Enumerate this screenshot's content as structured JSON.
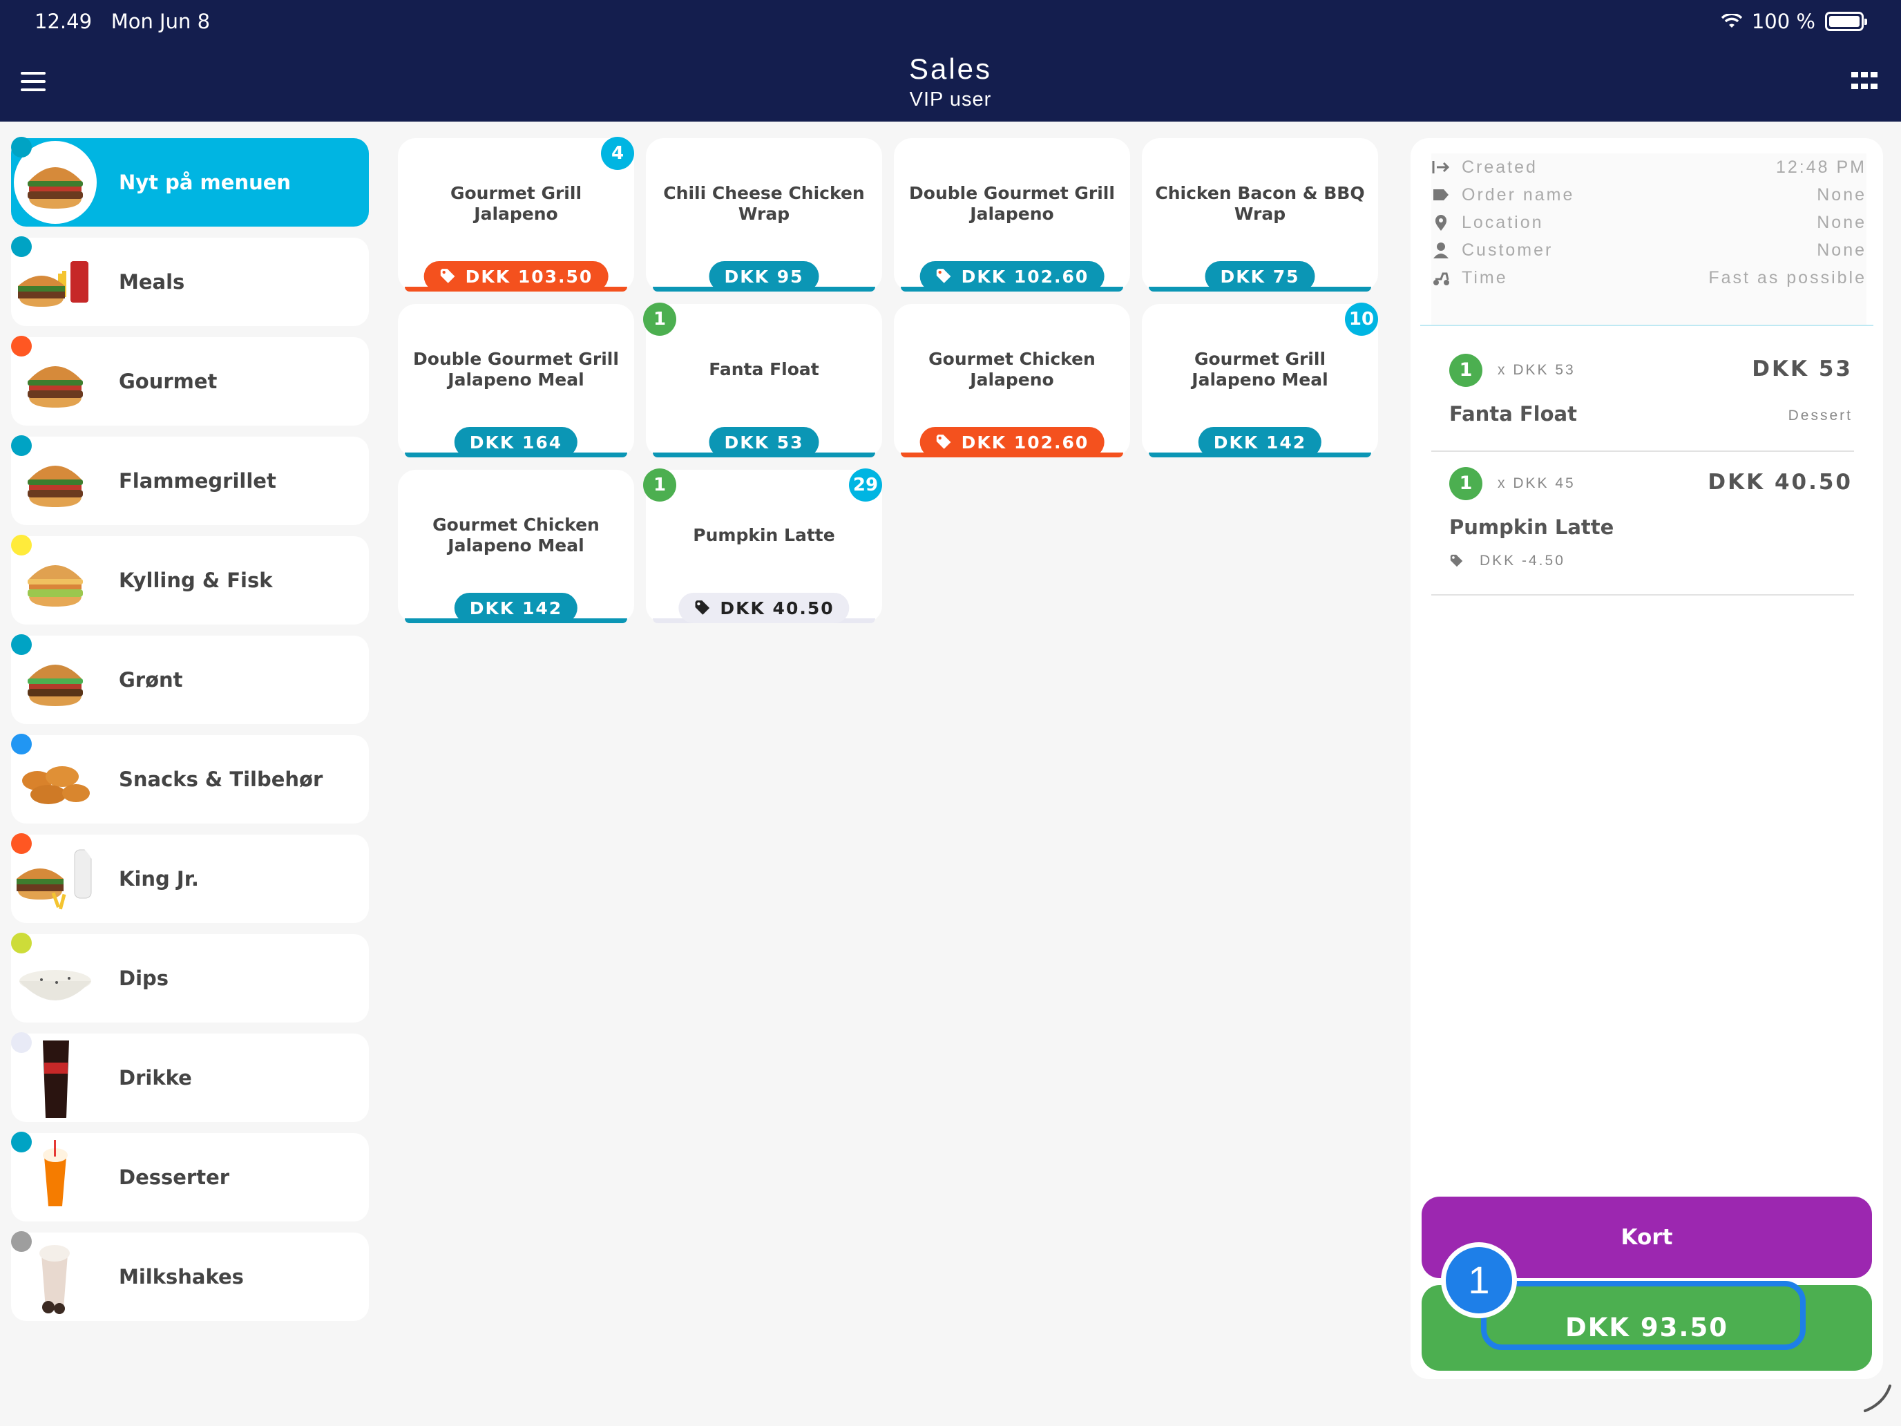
{
  "status": {
    "time": "12.49",
    "date": "Mon Jun 8",
    "battery": "100 %"
  },
  "header": {
    "title": "Sales",
    "subtitle": "VIP user"
  },
  "categories": [
    {
      "label": "Nyt på menuen",
      "dot": "#00a3c4",
      "active": true,
      "icon": "burger-icon"
    },
    {
      "label": "Meals",
      "dot": "#00a3c4",
      "icon": "meal-icon"
    },
    {
      "label": "Gourmet",
      "dot": "#ff5722",
      "icon": "burger-icon"
    },
    {
      "label": "Flammegrillet",
      "dot": "#00a3c4",
      "icon": "burger-icon"
    },
    {
      "label": "Kylling & Fisk",
      "dot": "#ffeb3b",
      "icon": "chicken-burger-icon"
    },
    {
      "label": "Grønt",
      "dot": "#00a3c4",
      "icon": "veggie-burger-icon"
    },
    {
      "label": "Snacks & Tilbehør",
      "dot": "#2196f3",
      "icon": "nuggets-icon"
    },
    {
      "label": "King Jr.",
      "dot": "#ff5722",
      "icon": "kids-meal-icon"
    },
    {
      "label": "Dips",
      "dot": "#cddc39",
      "icon": "dip-icon"
    },
    {
      "label": "Drikke",
      "dot": "#e8eaf6",
      "icon": "cola-icon"
    },
    {
      "label": "Desserter",
      "dot": "#00a3c4",
      "icon": "dessert-icon"
    },
    {
      "label": "Milkshakes",
      "dot": "#9e9e9e",
      "icon": "milkshake-icon"
    }
  ],
  "products": [
    {
      "name": "Gourmet Grill Jalapeno",
      "price": "DKK 103.50",
      "style": "discount",
      "badge": "4",
      "badge_side": "right",
      "badge_color": "#00b5e2"
    },
    {
      "name": "Chili Cheese Chicken Wrap",
      "price": "DKK 95",
      "style": "normal"
    },
    {
      "name": "Double Gourmet Grill Jalapeno",
      "price": "DKK 102.60",
      "style": "tagged"
    },
    {
      "name": "Chicken Bacon & BBQ Wrap",
      "price": "DKK 75",
      "style": "normal"
    },
    {
      "name": "Double Gourmet Grill Jalapeno Meal",
      "price": "DKK 164",
      "style": "normal"
    },
    {
      "name": "Fanta Float",
      "price": "DKK 53",
      "style": "normal",
      "badge": "1",
      "badge_side": "left",
      "badge_color": "#4caf50"
    },
    {
      "name": "Gourmet Chicken Jalapeno",
      "price": "DKK 102.60",
      "style": "discount"
    },
    {
      "name": "Gourmet Grill Jalapeno Meal",
      "price": "DKK 142",
      "style": "normal",
      "badge": "10",
      "badge_side": "right",
      "badge_color": "#00b5e2"
    },
    {
      "name": "Gourmet Chicken Jalapeno Meal",
      "price": "DKK 142",
      "style": "normal"
    },
    {
      "name": "Pumpkin Latte",
      "price": "DKK 40.50",
      "style": "light",
      "badge": "1",
      "badge_side": "left",
      "badge_color": "#4caf50",
      "badge2": "29",
      "badge2_color": "#00b5e2"
    }
  ],
  "order_info": [
    {
      "key": "Created",
      "value": "12:48 PM",
      "icon": "arrow-in-icon"
    },
    {
      "key": "Order name",
      "value": "None",
      "icon": "tag-icon"
    },
    {
      "key": "Location",
      "value": "None",
      "icon": "location-pin-icon"
    },
    {
      "key": "Customer",
      "value": "None",
      "icon": "person-icon"
    },
    {
      "key": "Time",
      "value": "Fast as possible",
      "icon": "delivery-icon"
    }
  ],
  "order_lines": [
    {
      "qty": "1",
      "unit": "x DKK 53",
      "total": "DKK 53",
      "name": "Fanta Float",
      "category": "Dessert"
    },
    {
      "qty": "1",
      "unit": "x DKK 45",
      "total": "DKK 40.50",
      "name": "Pumpkin Latte",
      "discount": "DKK -4.50"
    }
  ],
  "actions": {
    "kort_label": "Kort",
    "total_label": "DKK 93.50",
    "step": "1"
  },
  "colors": {
    "header": "#141e4e",
    "accent": "#00b5e2",
    "discount": "#f4511e",
    "price": "#0b96b5",
    "kort": "#9c27b0",
    "total": "#4caf50",
    "highlight": "#1e7fe8"
  }
}
